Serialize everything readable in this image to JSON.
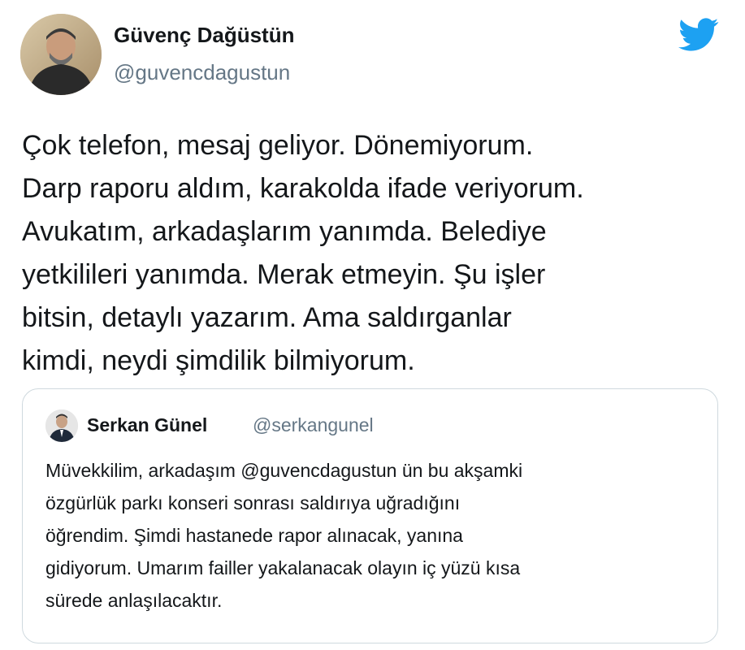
{
  "tweet": {
    "author": {
      "display_name": "Güvenç Dağüstün",
      "handle": "@guvencdagustun",
      "avatar_icon": "user-photo"
    },
    "logo_icon": "twitter-bird-icon",
    "brand_color": "#1da1f2",
    "text_lines": [
      "Çok telefon, mesaj geliyor. Dönemiyorum.",
      "Darp raporu aldım, karakolda ifade veriyorum.",
      "Avukatım, arkadaşlarım yanımda. Belediye",
      "yetkilileri yanımda. Merak etmeyin. Şu işler",
      "bitsin, detaylı yazarım. Ama saldırganlar",
      "kimdi, neydi şimdilik bilmiyorum."
    ]
  },
  "quoted_tweet": {
    "author": {
      "display_name": "Serkan Günel",
      "handle": "@serkangunel",
      "avatar_icon": "user-photo"
    },
    "text_lines": [
      "Müvekkilim, arkadaşım @guvencdagustun ün bu akşamki",
      "özgürlük parkı konseri sonrası saldırıya uğradığını",
      "öğrendim. Şimdi hastanede rapor alınacak, yanına",
      "gidiyorum. Umarım failler yakalanacak olayın iç yüzü kısa",
      "sürede anlaşılacaktır."
    ]
  }
}
